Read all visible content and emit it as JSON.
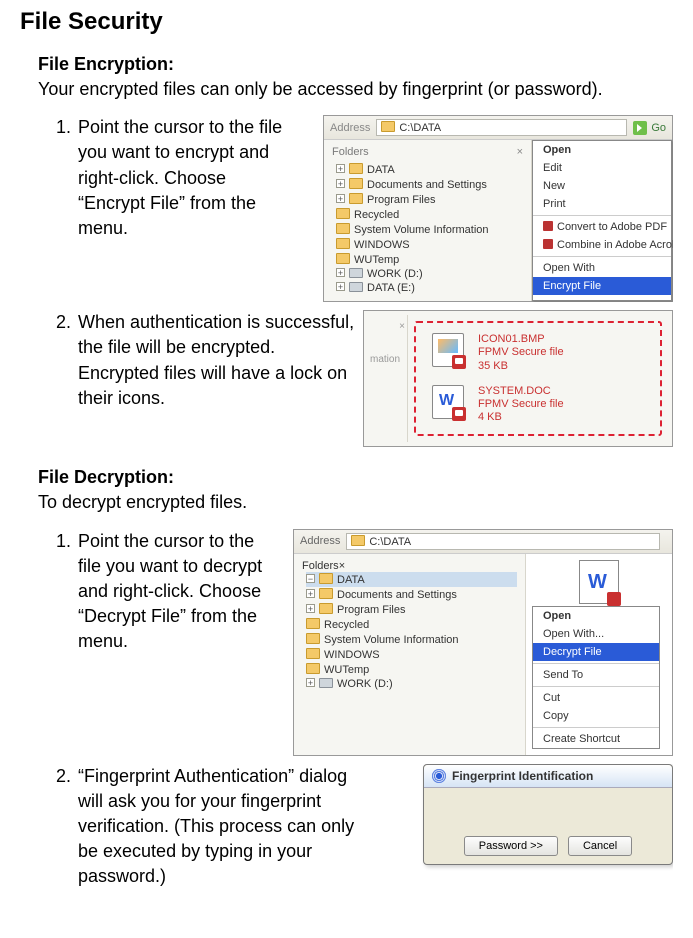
{
  "title": "File Security",
  "encryption": {
    "heading": "File Encryption:",
    "desc": "Your encrypted files can only be accessed by fingerprint (or password).",
    "steps": [
      "Point the cursor to the file you want to encrypt and right-click. Choose “Encrypt File” from the menu.",
      "When authentication is successful, the file will be encrypted. Encrypted files will have a lock on their icons."
    ]
  },
  "decryption": {
    "heading": "File Decryption:",
    "desc": "To decrypt encrypted files.",
    "steps": [
      "Point the cursor to the file you want to decrypt and right-click. Choose “Decrypt File” from the menu.",
      "“Fingerprint Authentication” dialog will ask you for your fingerprint verification. (This process can only be executed by typing in your password.)"
    ]
  },
  "explorer": {
    "address_label": "Address",
    "path": "C:\\DATA",
    "go": "Go",
    "folders_label": "Folders",
    "tree": [
      "DATA",
      "Documents and Settings",
      "Program Files",
      "Recycled",
      "System Volume Information",
      "WINDOWS",
      "WUTemp"
    ],
    "drives": [
      "WORK (D:)",
      "DATA (E:)"
    ],
    "mation_fragment": "mation"
  },
  "context_encrypt": {
    "open": "Open",
    "edit": "Edit",
    "new": "New",
    "print": "Print",
    "convert": "Convert to Adobe PDF",
    "combine": "Combine in Adobe Acrobat...",
    "openwith": "Open With",
    "encrypt": "Encrypt File"
  },
  "encrypted_files": [
    {
      "name": "ICON01.BMP",
      "sub": "FPMV Secure file",
      "size": "35 KB"
    },
    {
      "name": "SYSTEM.DOC",
      "sub": "FPMV Secure file",
      "size": "4 KB"
    }
  ],
  "context_decrypt": {
    "open": "Open",
    "openwith": "Open With...",
    "decrypt": "Decrypt File",
    "sendto": "Send To",
    "cut": "Cut",
    "copy": "Copy",
    "shortcut": "Create Shortcut"
  },
  "fp_dialog": {
    "title": "Fingerprint Identification",
    "password_btn": "Password >>",
    "cancel_btn": "Cancel"
  }
}
